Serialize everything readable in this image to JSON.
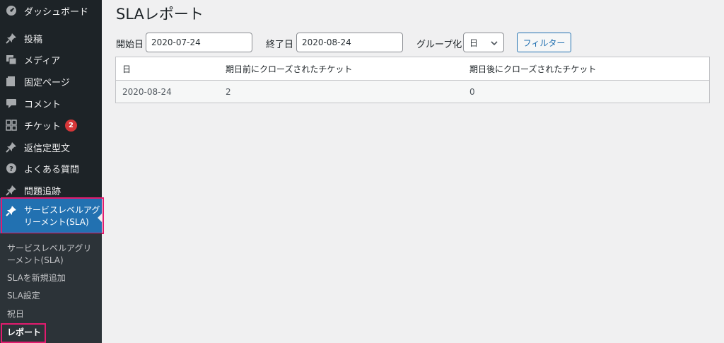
{
  "sidebar": {
    "items": [
      {
        "label": "ダッシュボード",
        "icon": "dashboard-icon"
      },
      {
        "label": "投稿",
        "icon": "pin-icon"
      },
      {
        "label": "メディア",
        "icon": "media-icon"
      },
      {
        "label": "固定ページ",
        "icon": "page-icon"
      },
      {
        "label": "コメント",
        "icon": "comment-icon"
      },
      {
        "label": "チケット",
        "icon": "ticket-icon",
        "badge": "2"
      },
      {
        "label": "返信定型文",
        "icon": "pin-icon"
      },
      {
        "label": "よくある質問",
        "icon": "help-icon"
      },
      {
        "label": "問題追跡",
        "icon": "pin-icon"
      }
    ],
    "current": {
      "label": "サービスレベルアグリーメント(SLA)",
      "icon": "pin-icon"
    },
    "submenu": [
      {
        "label": "サービスレベルアグリーメント(SLA)"
      },
      {
        "label": "SLAを新規追加"
      },
      {
        "label": "SLA設定"
      },
      {
        "label": "祝日"
      },
      {
        "label": "レポート",
        "active": true
      }
    ]
  },
  "page": {
    "title": "SLAレポート"
  },
  "filters": {
    "start_label": "開始日",
    "start_value": "2020-07-24",
    "end_label": "終了日",
    "end_value": "2020-08-24",
    "group_label": "グループ化",
    "group_value": "日",
    "filter_button": "フィルター"
  },
  "table": {
    "headers": [
      "日",
      "期日前にクローズされたチケット",
      "期日後にクローズされたチケット"
    ],
    "rows": [
      [
        "2020-08-24",
        "2",
        "0"
      ]
    ]
  },
  "colors": {
    "sidebar_bg": "#1d2327",
    "submenu_bg": "#2c3338",
    "accent": "#2271b1",
    "highlight_border": "#e21b6e",
    "badge": "#d63638"
  }
}
